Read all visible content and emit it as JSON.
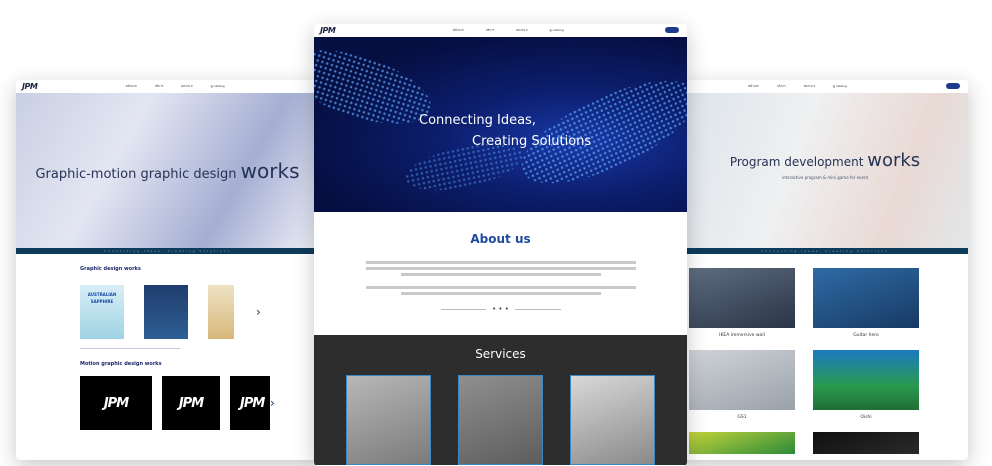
{
  "nav": {
    "logo": "JPM",
    "links": [
      "หน้าแรก",
      "บริการ",
      "ผลงาน ▾",
      "ดู catalog"
    ]
  },
  "strip": "Connecting Ideas, Creating Solutions",
  "left": {
    "hero_prefix": "Graphic-motion graphic design ",
    "hero_big": "works",
    "graphic_title": "Graphic design works",
    "thumb_line1": "AUSTRALIAN",
    "thumb_line2": "SAPPHIRE",
    "motion_title": "Motion graphic design works",
    "video_logo": "JPM",
    "arrow": "›"
  },
  "center": {
    "hero_line1": "Connecting Ideas,",
    "hero_line2": "Creating Solutions",
    "about_title": "About us",
    "about_dots": "• • •",
    "services_title": "Services"
  },
  "right": {
    "hero_prefix": "Program development ",
    "hero_big": "works",
    "hero_sub": "interactive program & mini game for event",
    "items": [
      "IKEA immersive wall",
      "Guitar hero",
      "GS1",
      "Oishi"
    ]
  },
  "colors": {
    "brand_navy": "#1f2a6b",
    "accent_blue": "#1f4aa0",
    "hero_deep_blue": "#0c1e6e",
    "services_bg": "#2d2d2d"
  }
}
